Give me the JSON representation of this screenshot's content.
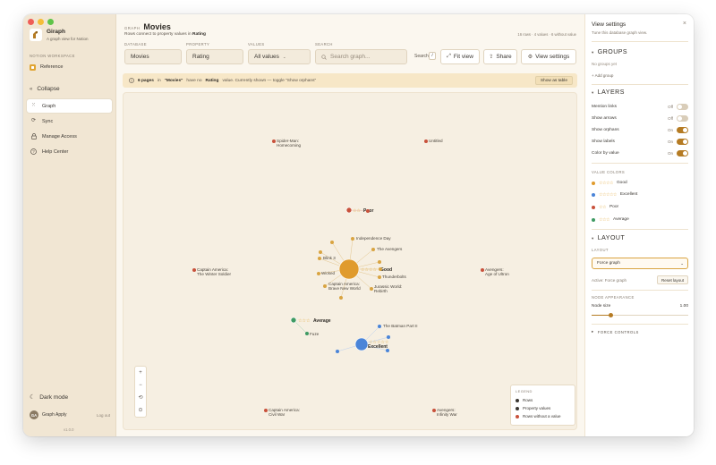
{
  "app": {
    "name": "Giraph",
    "tagline": "A graph view for Notion",
    "workspace_label": "NOTION WORKSPACE",
    "workspace_item": "Reference",
    "collapse_label": "Collapse",
    "nav": [
      {
        "label": "Graph",
        "icon": "graph-icon",
        "active": true
      },
      {
        "label": "Sync",
        "icon": "sync-icon",
        "active": false
      },
      {
        "label": "Manage Access",
        "icon": "lock-icon",
        "active": false
      },
      {
        "label": "Help Center",
        "icon": "help-icon",
        "active": false
      }
    ],
    "dark_mode_label": "Dark mode",
    "user": {
      "initials": "GA",
      "name": "Graph Apply",
      "logout": "Log out"
    },
    "version": "v1.0.0"
  },
  "header": {
    "type_label": "GRAPH",
    "title": "Movies",
    "subtitle_prefix": "Rows connect to property values in",
    "subtitle_bold": "Rating",
    "counts": "16 rows · 4 values · 6 without value"
  },
  "controls": {
    "database_label": "DATABASE",
    "database_value": "Movies",
    "property_label": "PROPERTY",
    "property_value": "Rating",
    "values_label": "VALUES",
    "values_value": "All values",
    "search_label": "SEARCH",
    "search_placeholder": "Search graph...",
    "search_hint": "Search",
    "search_kbd": "/",
    "fit_view": "Fit view",
    "share": "Share",
    "view_settings": "View settings"
  },
  "notice": {
    "count": "6 pages",
    "mid": "in",
    "db": "\"Movies\"",
    "mid2": "have no",
    "prop": "Rating",
    "rest": "value. Currently shown — toggle \"Show orphans\"",
    "button": "Show as table"
  },
  "graph": {
    "value_nodes": [
      {
        "label": "Good",
        "color": "#e09b2d",
        "stars": "☆☆☆☆"
      },
      {
        "label": "Poor",
        "color": "#c8513b",
        "stars": "☆☆"
      },
      {
        "label": "Average",
        "color": "#3e9a63",
        "stars": "☆☆☆"
      },
      {
        "label": "Excellent",
        "color": "#4a84d8",
        "stars": "☆☆☆☆☆"
      }
    ],
    "row_nodes": [
      "Independence Day",
      "The Avengers",
      "Blink 3",
      "Thunderbolts",
      "Wicked",
      "Captain America: Brave New World",
      "Jurassic World: Rebirth",
      "Fuze",
      "The Batman Part II"
    ],
    "orphans": [
      "Spider-Man: Homecoming",
      "Untitled",
      "Captain America: The Winter Soldier",
      "Avengers: Age of Ultron",
      "Captain America: Civil War",
      "Avengers: Infinity War"
    ]
  },
  "legend": {
    "title": "LEGEND",
    "items": [
      {
        "label": "Rows",
        "color": "#3a3631"
      },
      {
        "label": "Property values",
        "color": "#3a3631"
      },
      {
        "label": "Rows without a value",
        "color": "#c8513b"
      }
    ]
  },
  "panel": {
    "title": "View settings",
    "subtitle": "Tune this database graph view.",
    "groups_title": "GROUPS",
    "groups_empty": "No groups yet",
    "add_group": "+ Add group",
    "layers_title": "LAYERS",
    "toggles": [
      {
        "label": "Mention links",
        "state": "Off",
        "on": false
      },
      {
        "label": "Show arrows",
        "state": "Off",
        "on": false
      },
      {
        "label": "Show orphans",
        "state": "On",
        "on": true
      },
      {
        "label": "Show labels",
        "state": "On",
        "on": true
      },
      {
        "label": "Color by value",
        "state": "On",
        "on": true
      }
    ],
    "value_colors_label": "VALUE COLORS",
    "value_colors": [
      {
        "stars": "☆☆☆☆",
        "label": "Good",
        "color": "#e09b2d"
      },
      {
        "stars": "☆☆☆☆☆",
        "label": "Excellent",
        "color": "#4a84d8"
      },
      {
        "stars": "☆☆",
        "label": "Poor",
        "color": "#c8513b"
      },
      {
        "stars": "☆☆☆",
        "label": "Average",
        "color": "#3e9a63"
      }
    ],
    "layout_title": "LAYOUT",
    "layout_label": "LAYOUT",
    "layout_value": "Force graph",
    "active_text": "Active: Force graph",
    "reset_layout": "Reset layout",
    "node_appearance_label": "NODE APPEARANCE",
    "node_size_label": "Node size",
    "node_size_value": "1.00",
    "node_size_fraction": 0.2,
    "force_controls": "FORCE CONTROLS"
  },
  "colors": {
    "accent": "#b57b23",
    "good": "#e09b2d",
    "poor": "#c8513b",
    "average": "#3e9a63",
    "excellent": "#4a84d8",
    "row": "#d9a441"
  }
}
